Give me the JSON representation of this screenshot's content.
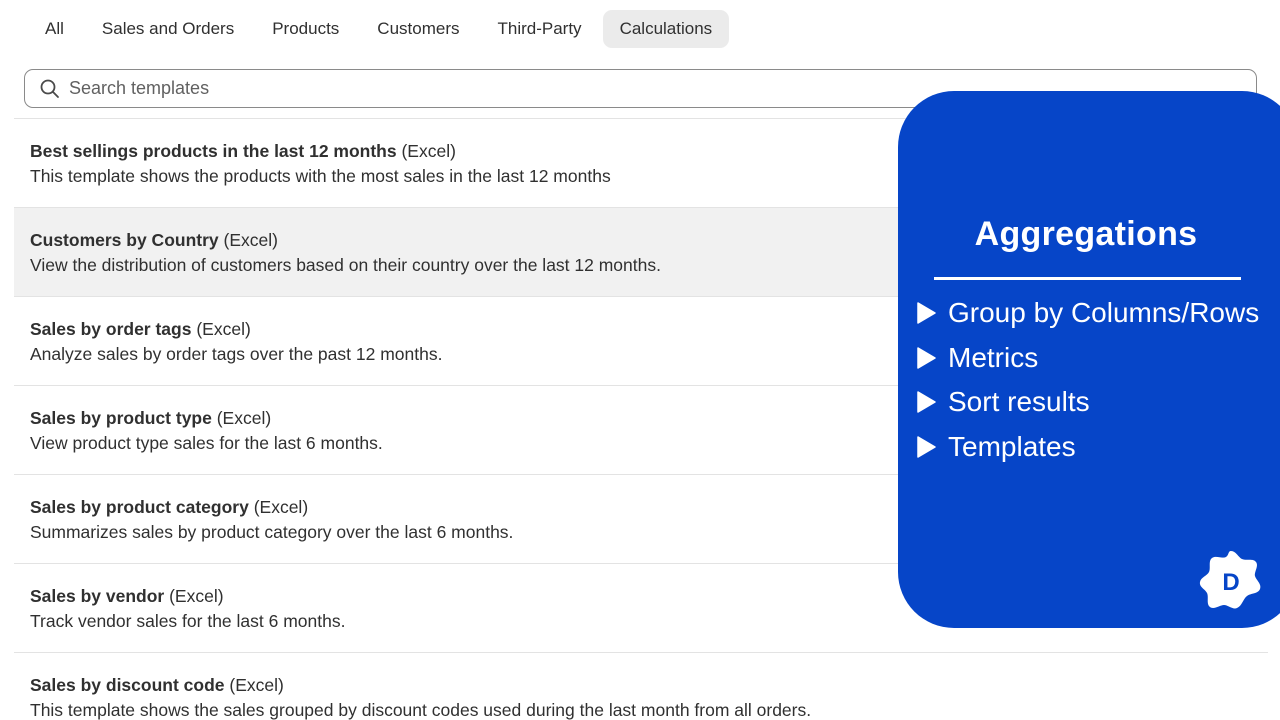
{
  "tabs": [
    {
      "label": "All",
      "active": false
    },
    {
      "label": "Sales and Orders",
      "active": false
    },
    {
      "label": "Products",
      "active": false
    },
    {
      "label": "Customers",
      "active": false
    },
    {
      "label": "Third-Party",
      "active": false
    },
    {
      "label": "Calculations",
      "active": true
    }
  ],
  "search": {
    "placeholder": "Search templates",
    "value": "",
    "icon": "search-icon"
  },
  "templates": [
    {
      "name": "Best sellings products in the last 12 months",
      "format": "(Excel)",
      "description": "This template shows the products with the most sales in the last 12 months"
    },
    {
      "name": "Customers by Country",
      "format": "(Excel)",
      "description": "View the distribution of customers based on their country over the last 12 months.",
      "highlighted": true
    },
    {
      "name": "Sales by order tags",
      "format": "(Excel)",
      "description": "Analyze sales by order tags over the past 12 months."
    },
    {
      "name": "Sales by product type",
      "format": "(Excel)",
      "description": "View product type sales for the last 6 months."
    },
    {
      "name": "Sales by product category",
      "format": "(Excel)",
      "description": "Summarizes sales by product category over the last 6 months."
    },
    {
      "name": "Sales by vendor",
      "format": "(Excel)",
      "description": "Track vendor sales for the last 6 months."
    },
    {
      "name": "Sales by discount code",
      "format": "(Excel)",
      "description": "This template shows the sales grouped by discount codes used during the last month from all orders."
    }
  ],
  "panel": {
    "title": "Aggregations",
    "features": [
      "Group by Columns/Rows",
      "Metrics",
      "Sort results",
      "Templates"
    ],
    "logo_letter": "D"
  },
  "colors": {
    "panel_bg": "#0645c8",
    "tab_active_bg": "#ebebeb",
    "row_highlight_bg": "#f1f1f1",
    "text": "#303030"
  }
}
